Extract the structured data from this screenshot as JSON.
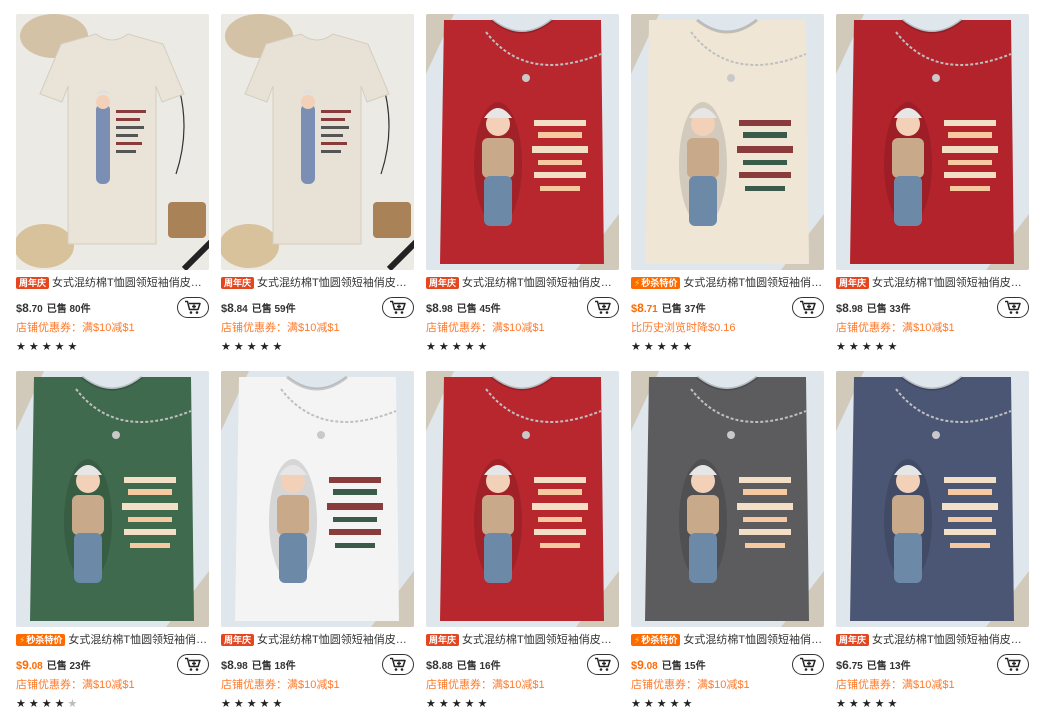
{
  "products": [
    {
      "badge": "周年庆",
      "badge_type": "normal",
      "title": "女式混纺棉T恤圆领短袖俏皮卡通女...",
      "price_int": "8",
      "price_dec": ".70",
      "currency": "$",
      "sold": "已售 80件",
      "coupon": "店铺优惠券：满$10减$1",
      "stars": "★★★★★",
      "shirt_color": "#e9e3d8",
      "bg": "#eceae5",
      "layout": "flat-beige",
      "design_text": "I'm not GETTING OLD"
    },
    {
      "badge": "周年庆",
      "badge_type": "normal",
      "title": "女式混纺棉T恤圆领短袖俏皮卡通女...",
      "price_int": "8",
      "price_dec": ".84",
      "currency": "$",
      "sold": "已售 59件",
      "coupon": "店铺优惠券：满$10减$1",
      "stars": "★★★★★",
      "shirt_color": "#e7e1d6",
      "bg": "#eceae5",
      "layout": "flat-beige",
      "design_text": "I'm multitasking"
    },
    {
      "badge": "周年庆",
      "badge_type": "normal",
      "title": "女式混纺棉T恤圆领短袖俏皮女性露...",
      "price_int": "8",
      "price_dec": ".98",
      "currency": "$",
      "sold": "已售 45件",
      "coupon": "店铺优惠券：满$10减$1",
      "stars": "★★★★★",
      "shirt_color": "#b8262e",
      "bg": "#dfe6ec",
      "layout": "folded",
      "design_text": "I'M NOT AGING, I'm just LEVELING UP!"
    },
    {
      "badge": "秒杀特价",
      "badge_type": "flash",
      "title": "女式混纺棉T恤圆领短袖俏皮卡通女...",
      "price_int": "8",
      "price_dec": ".71",
      "currency": "$",
      "sold": "已售 37件",
      "coupon": "比历史浏览时降$0.16",
      "stars": "★★★★★",
      "shirt_color": "#efe6d6",
      "bg": "#dfe6ec",
      "layout": "folded",
      "design_text": "I'M NOT OLD I'M VINTAGE HIGHLY COLLECTIBLE and LIMITED EDITION"
    },
    {
      "badge": "周年庆",
      "badge_type": "normal",
      "title": "女式混纺棉T恤圆领短袖俏皮女性花...",
      "price_int": "8",
      "price_dec": ".98",
      "currency": "$",
      "sold": "已售 33件",
      "coupon": "店铺优惠券：满$10减$1",
      "stars": "★★★★★",
      "shirt_color": "#b3232c",
      "bg": "#dfe6ec",
      "layout": "folded",
      "design_text": "AGE is just a NUMBER ATTITUDE is EVERYTHING"
    },
    {
      "badge": "秒杀特价",
      "badge_type": "flash",
      "title": "女式混纺棉T恤圆领短袖俏皮卡通...",
      "price_int": "9",
      "price_dec": ".08",
      "currency": "$",
      "sold": "已售 23件",
      "coupon": "店铺优惠券：满$10减$1",
      "stars": "★★★★",
      "half_star": "★",
      "shirt_color": "#3f6a4d",
      "bg": "#dfe6ec",
      "layout": "folded",
      "design_text": "Age is just a number Attitude is everything"
    },
    {
      "badge": "周年庆",
      "badge_type": "normal",
      "title": "女式混纺棉T恤圆领短袖俏皮女性画...",
      "price_int": "8",
      "price_dec": ".98",
      "currency": "$",
      "sold": "已售 18件",
      "coupon": "店铺优惠券：满$10减$1",
      "stars": "★★★★★",
      "shirt_color": "#f4f4f4",
      "bg": "#dfe6ec",
      "layout": "folded",
      "design_text": "STAY WILD stay KIND and UNAPOLOGETICALLY YOU"
    },
    {
      "badge": "周年庆",
      "badge_type": "normal",
      "title": "女式混纺棉T恤圆领短袖俏皮卡通人...",
      "price_int": "8",
      "price_dec": ".88",
      "currency": "$",
      "sold": "已售 16件",
      "coupon": "店铺优惠券：满$10减$1",
      "stars": "★★★★★",
      "shirt_color": "#b8262e",
      "bg": "#dfe6ec",
      "layout": "folded",
      "design_text": "I don't need therapy"
    },
    {
      "badge": "秒杀特价",
      "badge_type": "flash",
      "title": "女式混纺棉T恤圆领短袖俏皮卡通...",
      "price_int": "9",
      "price_dec": ".08",
      "currency": "$",
      "sold": "已售 15件",
      "coupon": "店铺优惠券：满$10减$1",
      "stars": "★★★★★",
      "shirt_color": "#5c5c5e",
      "bg": "#dfe6ec",
      "layout": "folded",
      "design_text": "BRAVE SPIRIT"
    },
    {
      "badge": "周年庆",
      "badge_type": "normal",
      "title": "女式混纺棉T恤圆领短袖俏皮女性角...",
      "price_int": "6",
      "price_dec": ".75",
      "currency": "$",
      "sold": "已售 13件",
      "coupon": "店铺优惠券：满$10减$1",
      "stars": "★★★★★",
      "shirt_color": "#4b5675",
      "bg": "#dfe6ec",
      "layout": "folded",
      "design_text": "BUCKLE UP BUTTERCUP YOU JUST"
    }
  ]
}
